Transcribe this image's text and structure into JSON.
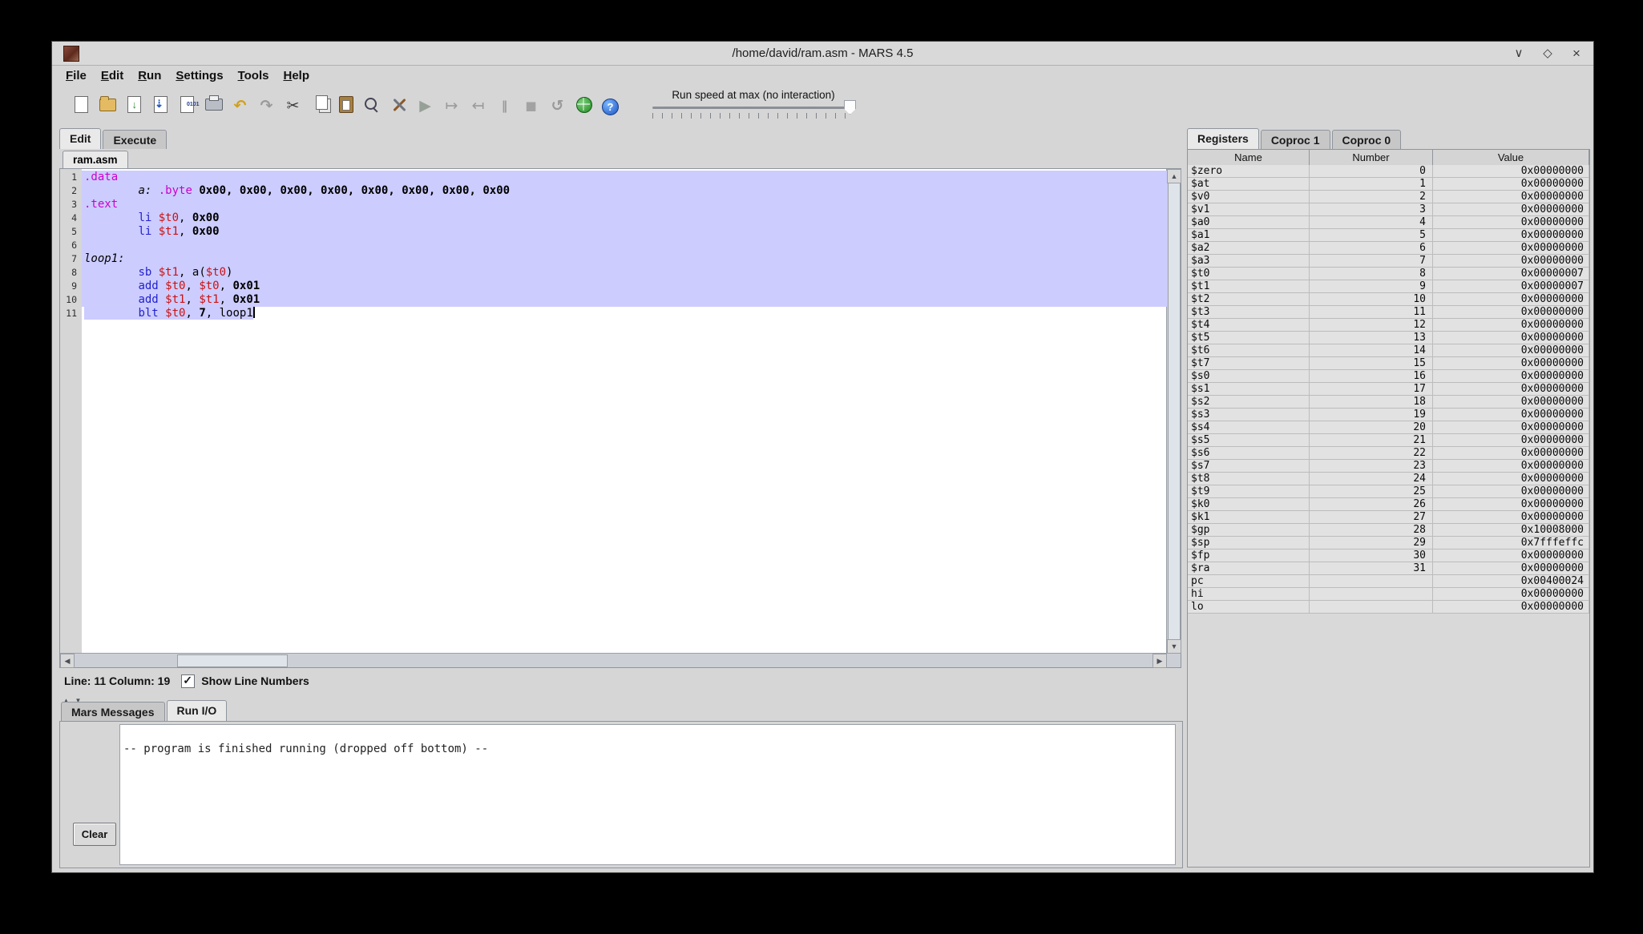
{
  "window": {
    "title": "/home/david/ram.asm - MARS 4.5"
  },
  "menu": {
    "items": [
      "File",
      "Edit",
      "Run",
      "Settings",
      "Tools",
      "Help"
    ]
  },
  "toolbar": {
    "icons": [
      "new-file",
      "open-file",
      "save",
      "save-as",
      "dump-memory",
      "print",
      "undo",
      "redo",
      "cut",
      "copy",
      "paste",
      "find-replace",
      "assemble",
      "run",
      "step",
      "backstep",
      "pause",
      "stop",
      "reset",
      "help-globe",
      "help"
    ],
    "run_speed_label": "Run speed at max (no interaction)"
  },
  "main_tabs": {
    "items": [
      {
        "label": "Edit",
        "active": true
      },
      {
        "label": "Execute",
        "active": false
      }
    ]
  },
  "editor": {
    "file_tab": "ram.asm",
    "status_text": "Line: 11 Column: 19",
    "show_line_numbers_label": "Show Line Numbers",
    "lines": [
      {
        "num": 1,
        "sel": "full",
        "tokens": [
          {
            "t": ".data",
            "c": "dir"
          }
        ]
      },
      {
        "num": 2,
        "sel": "full",
        "tokens": [
          {
            "t": "        ",
            "c": "pl"
          },
          {
            "t": "a:",
            "c": "lbl"
          },
          {
            "t": " ",
            "c": "pl"
          },
          {
            "t": ".byte",
            "c": "dir"
          },
          {
            "t": " ",
            "c": "pl"
          },
          {
            "t": "0x00, 0x00, 0x00, 0x00, 0x00, 0x00, 0x00, 0x00",
            "c": "num"
          }
        ]
      },
      {
        "num": 3,
        "sel": "full",
        "tokens": [
          {
            "t": ".text",
            "c": "dir"
          }
        ]
      },
      {
        "num": 4,
        "sel": "full",
        "tokens": [
          {
            "t": "        ",
            "c": "pl"
          },
          {
            "t": "li",
            "c": "ins"
          },
          {
            "t": " ",
            "c": "pl"
          },
          {
            "t": "$t0",
            "c": "reg"
          },
          {
            "t": ", ",
            "c": "pl"
          },
          {
            "t": "0x00",
            "c": "num"
          }
        ]
      },
      {
        "num": 5,
        "sel": "full",
        "tokens": [
          {
            "t": "        ",
            "c": "pl"
          },
          {
            "t": "li",
            "c": "ins"
          },
          {
            "t": " ",
            "c": "pl"
          },
          {
            "t": "$t1",
            "c": "reg"
          },
          {
            "t": ", ",
            "c": "pl"
          },
          {
            "t": "0x00",
            "c": "num"
          }
        ]
      },
      {
        "num": 6,
        "sel": "full",
        "tokens": []
      },
      {
        "num": 7,
        "sel": "full",
        "tokens": [
          {
            "t": "loop1:",
            "c": "lbl"
          }
        ]
      },
      {
        "num": 8,
        "sel": "full",
        "tokens": [
          {
            "t": "        ",
            "c": "pl"
          },
          {
            "t": "sb",
            "c": "ins"
          },
          {
            "t": " ",
            "c": "pl"
          },
          {
            "t": "$t1",
            "c": "reg"
          },
          {
            "t": ", a(",
            "c": "pl"
          },
          {
            "t": "$t0",
            "c": "reg"
          },
          {
            "t": ")",
            "c": "pl"
          }
        ]
      },
      {
        "num": 9,
        "sel": "full",
        "tokens": [
          {
            "t": "        ",
            "c": "pl"
          },
          {
            "t": "add",
            "c": "ins"
          },
          {
            "t": " ",
            "c": "pl"
          },
          {
            "t": "$t0",
            "c": "reg"
          },
          {
            "t": ", ",
            "c": "pl"
          },
          {
            "t": "$t0",
            "c": "reg"
          },
          {
            "t": ", ",
            "c": "pl"
          },
          {
            "t": "0x01",
            "c": "num"
          }
        ]
      },
      {
        "num": 10,
        "sel": "full",
        "tokens": [
          {
            "t": "        ",
            "c": "pl"
          },
          {
            "t": "add",
            "c": "ins"
          },
          {
            "t": " ",
            "c": "pl"
          },
          {
            "t": "$t1",
            "c": "reg"
          },
          {
            "t": ", ",
            "c": "pl"
          },
          {
            "t": "$t1",
            "c": "reg"
          },
          {
            "t": ", ",
            "c": "pl"
          },
          {
            "t": "0x01",
            "c": "num"
          }
        ]
      },
      {
        "num": 11,
        "sel": "partial",
        "caret": true,
        "tokens": [
          {
            "t": "        ",
            "c": "pl"
          },
          {
            "t": "blt",
            "c": "ins"
          },
          {
            "t": " ",
            "c": "pl"
          },
          {
            "t": "$t0",
            "c": "reg"
          },
          {
            "t": ", ",
            "c": "pl"
          },
          {
            "t": "7",
            "c": "num"
          },
          {
            "t": ", ",
            "c": "pl"
          },
          {
            "t": "loop1",
            "c": "pl"
          }
        ]
      }
    ]
  },
  "console": {
    "tabs": [
      {
        "label": "Mars Messages",
        "active": false
      },
      {
        "label": "Run I/O",
        "active": true
      }
    ],
    "output": "-- program is finished running (dropped off bottom) --",
    "clear_label": "Clear"
  },
  "registers_panel": {
    "tabs": [
      {
        "label": "Registers",
        "active": true
      },
      {
        "label": "Coproc 1",
        "active": false
      },
      {
        "label": "Coproc 0",
        "active": false
      }
    ],
    "columns": [
      "Name",
      "Number",
      "Value"
    ],
    "rows": [
      [
        "$zero",
        "0",
        "0x00000000"
      ],
      [
        "$at",
        "1",
        "0x00000000"
      ],
      [
        "$v0",
        "2",
        "0x00000000"
      ],
      [
        "$v1",
        "3",
        "0x00000000"
      ],
      [
        "$a0",
        "4",
        "0x00000000"
      ],
      [
        "$a1",
        "5",
        "0x00000000"
      ],
      [
        "$a2",
        "6",
        "0x00000000"
      ],
      [
        "$a3",
        "7",
        "0x00000000"
      ],
      [
        "$t0",
        "8",
        "0x00000007"
      ],
      [
        "$t1",
        "9",
        "0x00000007"
      ],
      [
        "$t2",
        "10",
        "0x00000000"
      ],
      [
        "$t3",
        "11",
        "0x00000000"
      ],
      [
        "$t4",
        "12",
        "0x00000000"
      ],
      [
        "$t5",
        "13",
        "0x00000000"
      ],
      [
        "$t6",
        "14",
        "0x00000000"
      ],
      [
        "$t7",
        "15",
        "0x00000000"
      ],
      [
        "$s0",
        "16",
        "0x00000000"
      ],
      [
        "$s1",
        "17",
        "0x00000000"
      ],
      [
        "$s2",
        "18",
        "0x00000000"
      ],
      [
        "$s3",
        "19",
        "0x00000000"
      ],
      [
        "$s4",
        "20",
        "0x00000000"
      ],
      [
        "$s5",
        "21",
        "0x00000000"
      ],
      [
        "$s6",
        "22",
        "0x00000000"
      ],
      [
        "$s7",
        "23",
        "0x00000000"
      ],
      [
        "$t8",
        "24",
        "0x00000000"
      ],
      [
        "$t9",
        "25",
        "0x00000000"
      ],
      [
        "$k0",
        "26",
        "0x00000000"
      ],
      [
        "$k1",
        "27",
        "0x00000000"
      ],
      [
        "$gp",
        "28",
        "0x10008000"
      ],
      [
        "$sp",
        "29",
        "0x7fffeffc"
      ],
      [
        "$fp",
        "30",
        "0x00000000"
      ],
      [
        "$ra",
        "31",
        "0x00000000"
      ],
      [
        "pc",
        "",
        "0x00400024"
      ],
      [
        "hi",
        "",
        "0x00000000"
      ],
      [
        "lo",
        "",
        "0x00000000"
      ]
    ]
  },
  "colors": {
    "selection": "#ccccff",
    "directive": "#cc00cc",
    "instruction": "#2121cc",
    "register": "#cc1111"
  }
}
